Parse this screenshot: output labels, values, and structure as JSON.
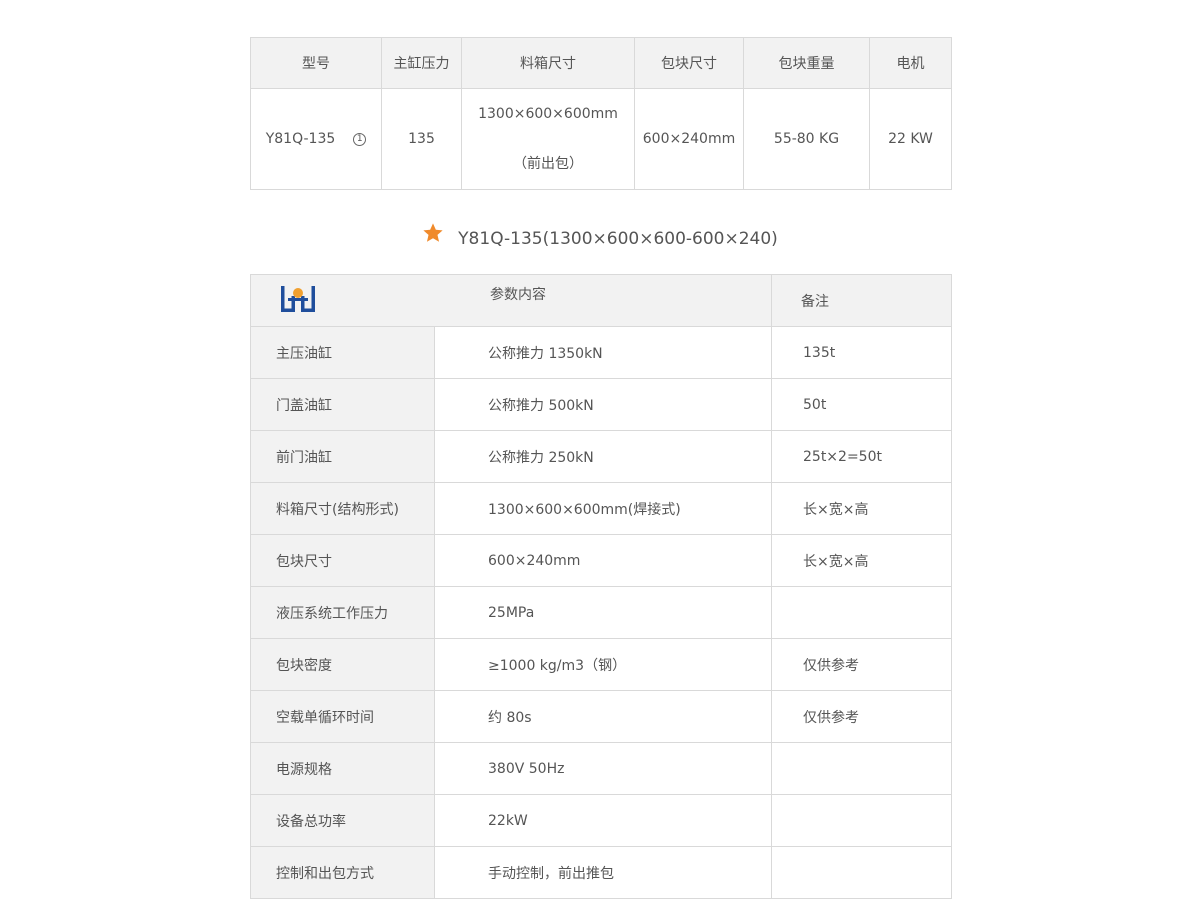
{
  "summary_table": {
    "headers": [
      "型号",
      "主缸压力",
      "料箱尺寸",
      "包块尺寸",
      "包块重量",
      "电机"
    ],
    "row": {
      "model": "Y81Q-135",
      "note_mark": "1",
      "pressure": "135",
      "box_size_line1": "1300×600×600mm",
      "box_size_line2": "（前出包）",
      "bale_size": "600×240mm",
      "bale_weight": "55-80 KG",
      "motor": "22 KW"
    }
  },
  "subtitle": {
    "text": "Y81Q-135(1300×600×600-600×240)",
    "star_color": "#f08a2b"
  },
  "spec_table": {
    "header_param": "参数内容",
    "header_note": "备注",
    "logo_color": "#1f4e9c",
    "logo_accent_color": "#f0a030",
    "rows": [
      {
        "name": "主压油缸",
        "value": "公称推力 1350kN",
        "note": "135t"
      },
      {
        "name": "门盖油缸",
        "value": "公称推力 500kN",
        "note": "50t"
      },
      {
        "name": "前门油缸",
        "value": "公称推力 250kN",
        "note": "25t×2=50t"
      },
      {
        "name": "料箱尺寸(结构形式)",
        "value": "1300×600×600mm(焊接式)",
        "note": "长×宽×高"
      },
      {
        "name": "包块尺寸",
        "value": "600×240mm",
        "note": "长×宽×高"
      },
      {
        "name": "液压系统工作压力",
        "value": "25MPa",
        "note": ""
      },
      {
        "name": "包块密度",
        "value": "≥1000 kg/m3（钢）",
        "note": "仅供参考"
      },
      {
        "name": "空载单循环时间",
        "value": "约 80s",
        "note": "仅供参考"
      },
      {
        "name": "电源规格",
        "value": "380V   50Hz",
        "note": ""
      },
      {
        "name": "设备总功率",
        "value": "22kW",
        "note": ""
      },
      {
        "name": "控制和出包方式",
        "value": "手动控制，前出推包",
        "note": ""
      }
    ]
  }
}
